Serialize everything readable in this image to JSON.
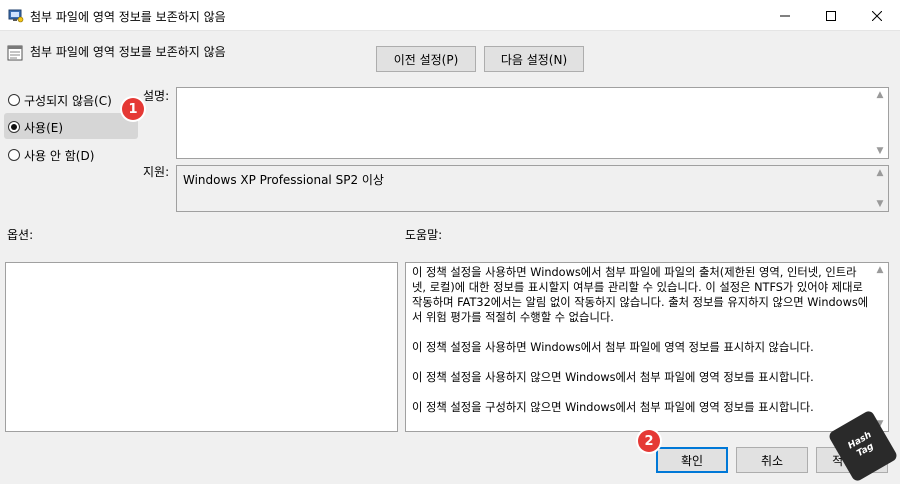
{
  "window": {
    "title": "첨부 파일에 영역 정보를 보존하지 않음",
    "app_icon": "policy-editor-icon",
    "controls": [
      "minimize-icon",
      "maximize-icon",
      "close-icon"
    ]
  },
  "policy": {
    "title": "첨부 파일에 영역 정보를 보존하지 않음",
    "icon": "policy-setting-icon"
  },
  "nav": {
    "prev_label": "이전 설정(P)",
    "next_label": "다음 설정(N)"
  },
  "options_radio": {
    "items": [
      {
        "label": "구성되지 않음(C)",
        "checked": false
      },
      {
        "label": "사용(E)",
        "checked": true
      },
      {
        "label": "사용 안 함(D)",
        "checked": false
      }
    ]
  },
  "labels": {
    "description": "설명:",
    "supported_on": "지원:",
    "options": "옵션:",
    "help": "도움말:"
  },
  "fields": {
    "description_value": "",
    "supported_on_value": "Windows XP Professional SP2 이상"
  },
  "help": {
    "paragraphs": [
      "이 정책 설정을 사용하면 Windows에서 첨부 파일에 파일의 출처(제한된 영역, 인터넷, 인트라넷, 로컬)에 대한 정보를 표시할지 여부를 관리할 수 있습니다. 이 설정은 NTFS가 있어야 제대로 작동하며 FAT32에서는 알림 없이 작동하지 않습니다. 출처 정보를 유지하지 않으면 Windows에서 위험 평가를 적절히 수행할 수 없습니다.",
      "이 정책 설정을 사용하면 Windows에서 첨부 파일에 영역 정보를 표시하지 않습니다.",
      "이 정책 설정을 사용하지 않으면 Windows에서 첨부 파일에 영역 정보를 표시합니다.",
      "이 정책 설정을 구성하지 않으면 Windows에서 첨부 파일에 영역 정보를 표시합니다."
    ]
  },
  "footer": {
    "ok_label": "확인",
    "cancel_label": "취소",
    "apply_label": "적용(A)"
  },
  "annotations": {
    "badge_1": "1",
    "badge_2": "2",
    "watermark_line1": "Hash",
    "watermark_line2": "Tag"
  },
  "colors": {
    "accent": "#0078d7",
    "badge": "#e53935"
  }
}
